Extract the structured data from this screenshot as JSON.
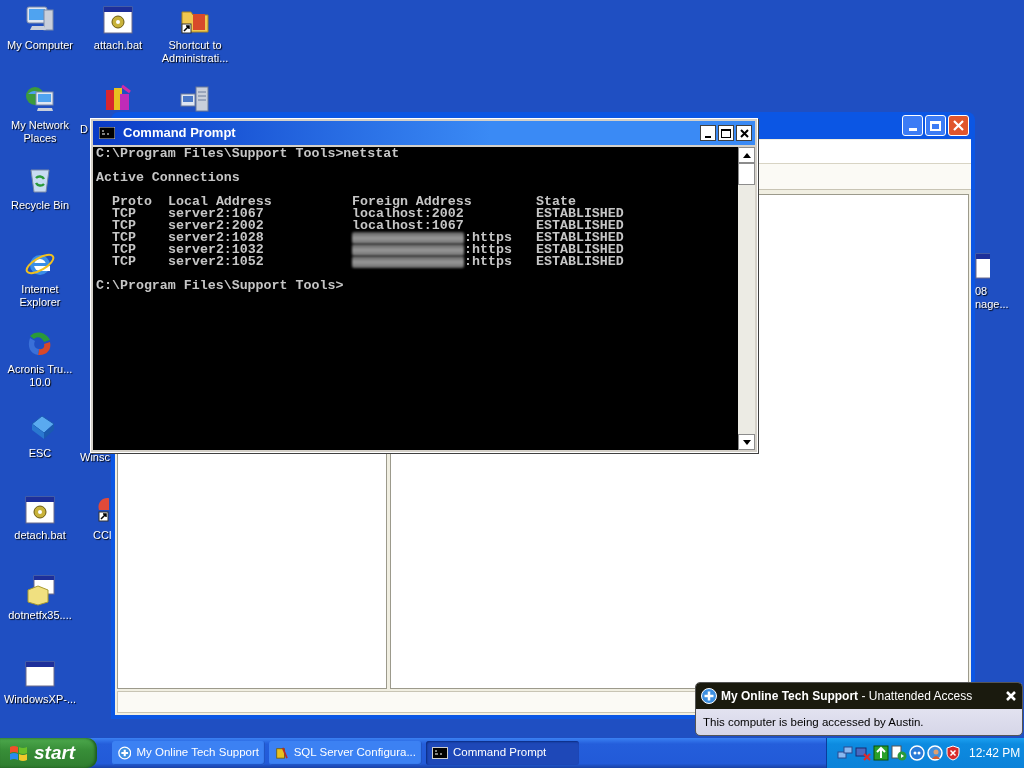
{
  "desktop_icons": [
    {
      "label": [
        "My Computer"
      ],
      "kind": "computer"
    },
    {
      "label": [
        "attach.bat"
      ],
      "kind": "batch"
    },
    {
      "label": [
        "Shortcut to",
        "Administrati..."
      ],
      "kind": "folder-shortcut"
    },
    {
      "label": [
        "My Network",
        "Places"
      ],
      "kind": "network"
    },
    {
      "label": [
        "D"
      ],
      "kind": "installer"
    },
    {
      "kind": "server"
    },
    {
      "label": [
        "Recycle Bin"
      ],
      "kind": "recycle"
    },
    {
      "label": [
        "Internet",
        "Explorer"
      ],
      "kind": "browser"
    },
    {
      "label": [
        "Acronis Tru...",
        "10.0"
      ],
      "kind": "swirl"
    },
    {
      "label": [
        "ESC"
      ],
      "kind": "key"
    },
    {
      "label": [
        "Winsc"
      ],
      "kind": "hidden"
    },
    {
      "label": [
        "detach.bat"
      ],
      "kind": "batch"
    },
    {
      "label": [
        "CCl"
      ],
      "kind": "partial"
    },
    {
      "label": [
        "dotnetfx35...."
      ],
      "kind": "package"
    },
    {
      "label": [
        "WindowsXP-..."
      ],
      "kind": "window"
    },
    {
      "label": [
        "08",
        "nage..."
      ],
      "kind": "window"
    }
  ],
  "command_prompt": {
    "title": "Command Prompt",
    "lines": [
      "C:\\Program Files\\Support Tools>netstat",
      "Active Connections"
    ],
    "header": [
      "Proto",
      "Local Address",
      "Foreign Address",
      "State"
    ],
    "rows": [
      {
        "proto": "TCP",
        "local": "server2:1067",
        "foreign": "localhost:2002",
        "redacted": false,
        "state": "ESTABLISHED"
      },
      {
        "proto": "TCP",
        "local": "server2:2002",
        "foreign": "localhost:1067",
        "redacted": false,
        "state": "ESTABLISHED"
      },
      {
        "proto": "TCP",
        "local": "server2:1028",
        "foreign": ":https",
        "redacted": true,
        "state": "ESTABLISHED"
      },
      {
        "proto": "TCP",
        "local": "server2:1032",
        "foreign": ":https",
        "redacted": true,
        "state": "ESTABLISHED"
      },
      {
        "proto": "TCP",
        "local": "server2:1052",
        "foreign": ":https",
        "redacted": true,
        "state": "ESTABLISHED"
      }
    ],
    "prompt": "C:\\Program Files\\Support Tools>"
  },
  "notification": {
    "title": "**My Online Tech Support** - Unattended Access",
    "message": "This computer is being accessed by Austin."
  },
  "taskbar": {
    "start": "start",
    "tasks": [
      {
        "label": "My Online Tech Support",
        "kind": "support",
        "selected": false
      },
      {
        "label": "SQL Server Configura...",
        "kind": "tools",
        "selected": false
      },
      {
        "label": "Command Prompt",
        "kind": "console",
        "selected": true
      }
    ],
    "clock": "12:42 PM"
  }
}
